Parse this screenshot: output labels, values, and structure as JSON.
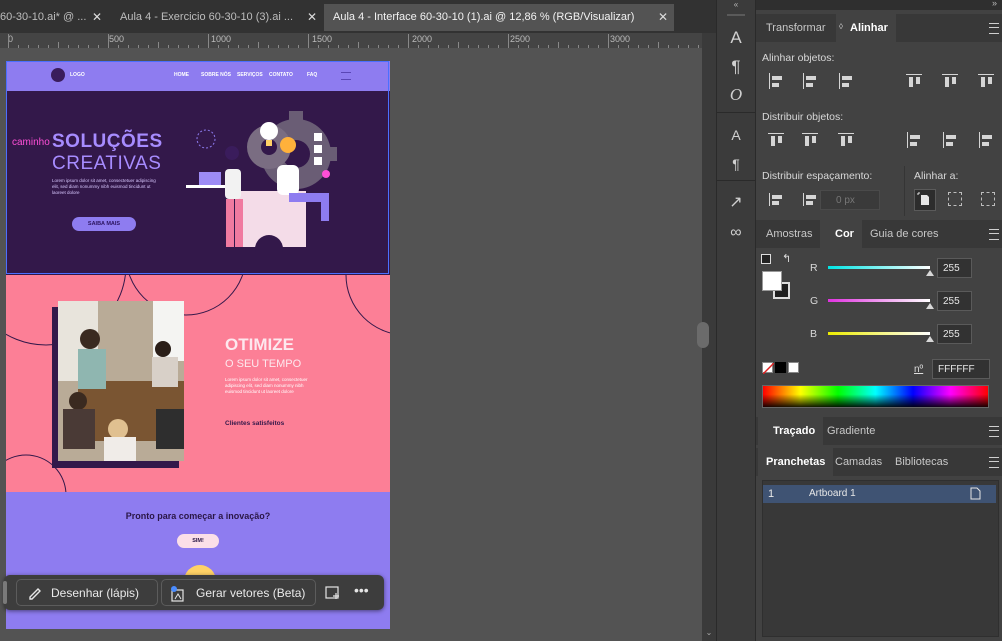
{
  "tabs": [
    {
      "label": "60-30-10.ai* @ ...",
      "active": false
    },
    {
      "label": "Aula 4 - Exercicio 60-30-10 (3).ai ...",
      "active": false
    },
    {
      "label": "Aula 4 - Interface 60-30-10 (1).ai @ 12,86 % (RGB/Visualizar)",
      "active": true
    }
  ],
  "ruler": {
    "labels": [
      "0",
      "500",
      "1000",
      "1500",
      "2000",
      "2500",
      "3000"
    ]
  },
  "artboard": {
    "header": {
      "logo": "LOGO",
      "nav": [
        "HOME",
        "SOBRE NÓS",
        "SERVIÇOS",
        "CONTATO",
        "FAQ"
      ]
    },
    "hero": {
      "tag": "caminho",
      "title": "SOLUÇÕES",
      "subtitle": "CREATIVAS",
      "body": "Lorem ipsum dolor sit amet, consectetuer adipiscing elit, sed diam nonummy nibh euismod tincidunt ut laoreet dolore",
      "button": "SAIBA MAIS"
    },
    "section2": {
      "title": "OTIMIZE",
      "subtitle": "O SEU TEMPO",
      "body": "Lorem ipsum dolor sit amet, consectetuer adipiscing elit, sed diam nonummy nibh euismod tincidunt ut laoreet dolore",
      "link": "Clientes satisfeitos"
    },
    "cta": {
      "title": "Pronto para começar a inovação?",
      "button": "SIM!"
    }
  },
  "floatbar": {
    "draw_label": "Desenhar (lápis)",
    "vectors_label": "Gerar vetores (Beta)",
    "more": "•••"
  },
  "panel_align": {
    "tabs": [
      "Transformar",
      "Alinhar"
    ],
    "align_objects": "Alinhar objetos:",
    "distribute_objects": "Distribuir objetos:",
    "distribute_spacing": "Distribuir espaçamento:",
    "align_to": "Alinhar a:",
    "spacing_value": "0 px"
  },
  "panel_color": {
    "tabs": [
      "Amostras",
      "Cor",
      "Guia de cores"
    ],
    "channels": [
      {
        "name": "R",
        "value": "255",
        "color": "#00e5e5"
      },
      {
        "name": "G",
        "value": "255",
        "color": "#e032e0"
      },
      {
        "name": "B",
        "value": "255",
        "color": "#ecec00"
      }
    ],
    "hex_label": "nº",
    "hex_value": "FFFFFF"
  },
  "panel_stroke": {
    "tabs": [
      "Traçado",
      "Gradiente"
    ]
  },
  "panel_artboards": {
    "tabs": [
      "Pranchetas",
      "Camadas",
      "Bibliotecas"
    ],
    "rows": [
      {
        "index": "1",
        "name": "Artboard 1"
      }
    ]
  },
  "colors": {
    "hero_bg": "#33184a",
    "header_bg": "#8e7cf0",
    "pink_bg": "#fc7f96",
    "violet_bg": "#8e7cf0",
    "accent": "#a78cff"
  }
}
